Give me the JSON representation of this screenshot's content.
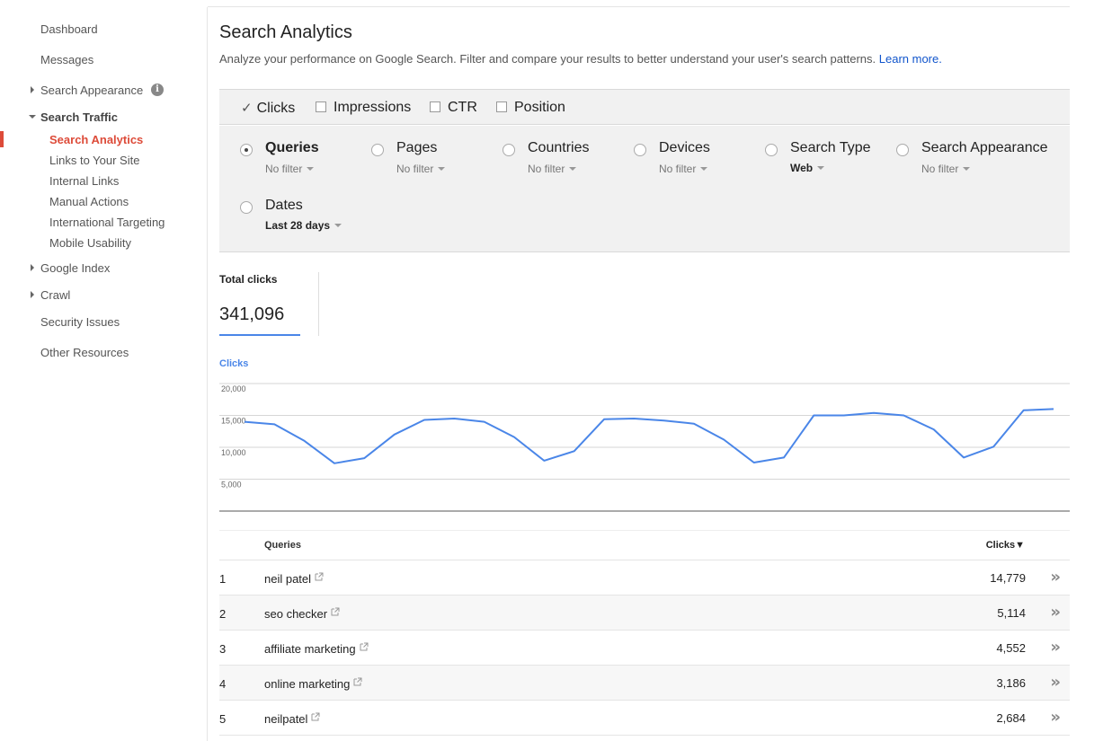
{
  "sidebar": {
    "dashboard": "Dashboard",
    "messages": "Messages",
    "search_appearance": "Search Appearance",
    "search_traffic": "Search Traffic",
    "sub_items": [
      "Search Analytics",
      "Links to Your Site",
      "Internal Links",
      "Manual Actions",
      "International Targeting",
      "Mobile Usability"
    ],
    "google_index": "Google Index",
    "crawl": "Crawl",
    "security_issues": "Security Issues",
    "other_resources": "Other Resources",
    "active_color": "#dd4b39"
  },
  "header": {
    "title": "Search Analytics",
    "description": "Analyze your performance on Google Search. Filter and compare your results to better understand your user's search patterns.",
    "learn_more": "Learn more."
  },
  "metrics": [
    {
      "label": "Clicks",
      "checked": true
    },
    {
      "label": "Impressions",
      "checked": false
    },
    {
      "label": "CTR",
      "checked": false
    },
    {
      "label": "Position",
      "checked": false
    }
  ],
  "filters": [
    {
      "label": "Queries",
      "value": "No filter",
      "selected": true
    },
    {
      "label": "Pages",
      "value": "No filter",
      "selected": false
    },
    {
      "label": "Countries",
      "value": "No filter",
      "selected": false
    },
    {
      "label": "Devices",
      "value": "No filter",
      "selected": false
    },
    {
      "label": "Search Type",
      "value": "Web",
      "selected": false
    },
    {
      "label": "Search Appearance",
      "value": "No filter",
      "selected": false
    },
    {
      "label": "Dates",
      "value": "Last 28 days",
      "selected": false
    }
  ],
  "totals": {
    "label": "Total clicks",
    "value": "341,096"
  },
  "chart_data": {
    "type": "line",
    "title": "",
    "ylabel": "Clicks",
    "ylim": [
      0,
      20000
    ],
    "yticks": [
      5000,
      10000,
      15000,
      20000
    ],
    "ytick_labels": [
      "5,000",
      "10,000",
      "15,000",
      "20,000"
    ],
    "grid": true,
    "series": [
      {
        "name": "Clicks",
        "color": "#4a86e8",
        "values": [
          14000,
          13600,
          11000,
          7500,
          8300,
          12000,
          14300,
          14500,
          14000,
          11600,
          7900,
          9400,
          14400,
          14500,
          14200,
          13700,
          11200,
          7600,
          8400,
          15000,
          15000,
          15400,
          15000,
          12800,
          8400,
          10100,
          15800,
          16000
        ]
      }
    ]
  },
  "table": {
    "col_query": "Queries",
    "col_clicks": "Clicks▼",
    "rows": [
      {
        "rank": "1",
        "query": "neil patel",
        "clicks": "14,779"
      },
      {
        "rank": "2",
        "query": "seo checker",
        "clicks": "5,114"
      },
      {
        "rank": "3",
        "query": "affiliate marketing",
        "clicks": "4,552"
      },
      {
        "rank": "4",
        "query": "online marketing",
        "clicks": "3,186"
      },
      {
        "rank": "5",
        "query": "neilpatel",
        "clicks": "2,684"
      }
    ]
  }
}
